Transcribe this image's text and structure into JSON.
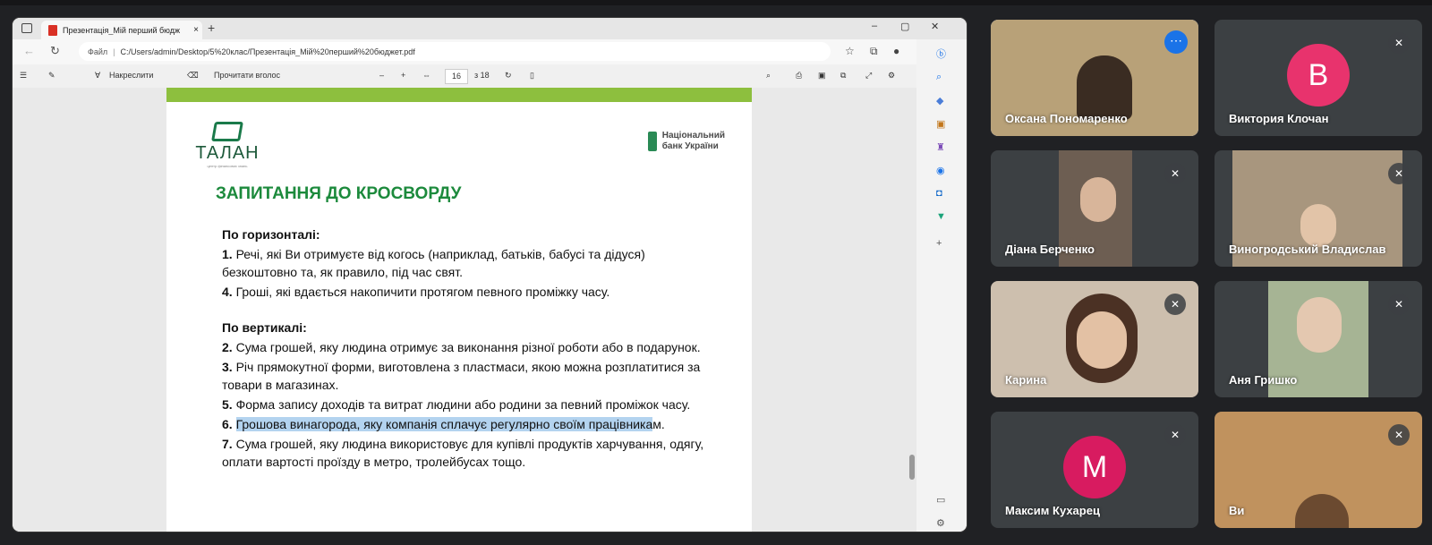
{
  "browser": {
    "tab_title": "Презентація_Мій перший бюдж",
    "tab_close": "×",
    "new_tab": "+",
    "url_label": "Файл",
    "url": "C:/Users/admin/Desktop/5%20клас/Презентація_Мій%20перший%20бюджет.pdf",
    "win_min": "–",
    "win_max": "▢",
    "win_close": "✕"
  },
  "pdf_toolbar": {
    "draw_label": "Накреслити",
    "read_aloud": "Прочитати вголос",
    "zoom_out": "–",
    "zoom_in": "+",
    "page_current": "16",
    "page_total": "з 18"
  },
  "slide": {
    "logo_name": "ТАЛАН",
    "logo_sub": "центр фінансових знань",
    "nbu_line1": "Національний",
    "nbu_line2": "банк України",
    "title": "ЗАПИТАННЯ ДО КРОСВОРДУ",
    "horizontal_head": "По горизонталі:",
    "horizontal": [
      {
        "num": "1.",
        "text": "Речі, які Ви отримуєте від когось (наприклад, батьків, бабусі та дідуся) безкоштовно та, як правило, під час свят."
      },
      {
        "num": "4.",
        "text": "Гроші, які вдається накопичити протягом певного проміжку часу."
      }
    ],
    "vertical_head": "По вертикалі:",
    "vertical": [
      {
        "num": "2.",
        "text": "Сума грошей, яку людина отримує за виконання різної роботи або в подарунок."
      },
      {
        "num": "3.",
        "text": "Річ прямокутної форми, виготовлена з пластмаси, якою можна розплатитися за товари в магазинах."
      },
      {
        "num": "5.",
        "text": "Форма запису доходів та витрат людини або родини за певний проміжок часу."
      },
      {
        "num": "6.",
        "text_hl": "Грошова винагорода, яку компанія сплачує регулярно своїм працівника",
        "text_tail": "м."
      },
      {
        "num": "7.",
        "text": "Сума грошей, яку людина використовує для купівлі продуктів харчування, одягу, оплати вартості проїзду в метро, тролейбусах тощо."
      }
    ]
  },
  "participants": [
    {
      "name": "Оксана Пономаренко",
      "type": "video",
      "bg": "#b59a6c",
      "active": true
    },
    {
      "name": "Виктория Клочан",
      "type": "avatar",
      "letter": "В",
      "color": "#e8336d"
    },
    {
      "name": "Діана Берченко",
      "type": "video",
      "bg": "#7d6e62"
    },
    {
      "name": "Виногродський Владислав",
      "type": "video",
      "bg": "#9b8a74"
    },
    {
      "name": "Карина",
      "type": "video",
      "bg": "#c9b9a8"
    },
    {
      "name": "Аня Гришко",
      "type": "video",
      "bg": "#9eaf8c"
    },
    {
      "name": "Максим Кухарец",
      "type": "avatar",
      "letter": "М",
      "color": "#d81b60"
    },
    {
      "name": "Ви",
      "type": "video",
      "bg": "#b88752"
    }
  ],
  "colors": {
    "meet_bg": "#202124",
    "tile_bg": "#3c4043",
    "accent": "#8ab4f8",
    "slide_title": "#1c8a3c"
  }
}
